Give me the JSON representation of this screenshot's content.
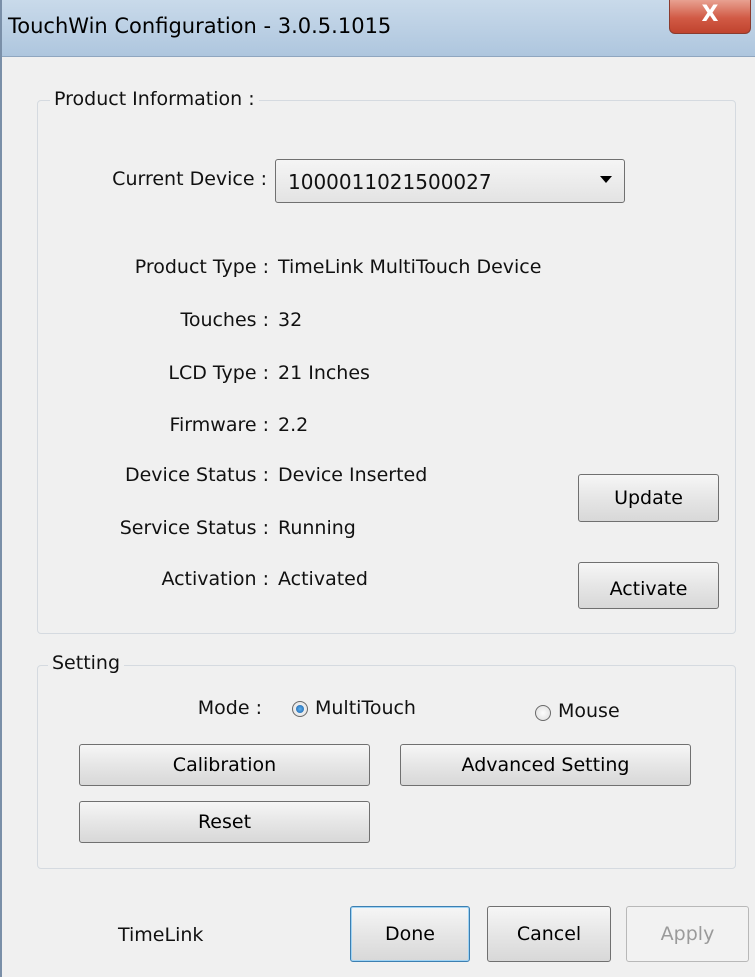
{
  "window": {
    "title": "TouchWin Configuration - 3.0.5.1015",
    "close_glyph": "X"
  },
  "product_info": {
    "legend": "Product Information :",
    "current_device_label": "Current Device :",
    "current_device_value": "1000011021500027",
    "rows": [
      {
        "label": "Product Type :",
        "value": "TimeLink MultiTouch Device"
      },
      {
        "label": "Touches :",
        "value": "32"
      },
      {
        "label": "LCD Type :",
        "value": "21 Inches"
      },
      {
        "label": "Firmware :",
        "value": "2.2"
      },
      {
        "label": "Device Status :",
        "value": "Device Inserted"
      },
      {
        "label": "Service Status :",
        "value": "Running"
      },
      {
        "label": "Activation :",
        "value": "Activated"
      }
    ],
    "update_label": "Update",
    "activate_label": "Activate"
  },
  "setting": {
    "legend": "Setting",
    "mode_label": "Mode :",
    "mode_options": [
      {
        "label": "MultiTouch",
        "selected": true
      },
      {
        "label": "Mouse",
        "selected": false
      }
    ],
    "calibration_label": "Calibration",
    "advanced_label": "Advanced Setting",
    "reset_label": "Reset"
  },
  "footer": {
    "brand": "TimeLink",
    "done_label": "Done",
    "cancel_label": "Cancel",
    "apply_label": "Apply"
  },
  "colors": {
    "titlebar": "#b9cee3",
    "close_button": "#c0432e",
    "default_button_border": "#3c7fb1",
    "radio_selected": "#1c5fa6"
  }
}
